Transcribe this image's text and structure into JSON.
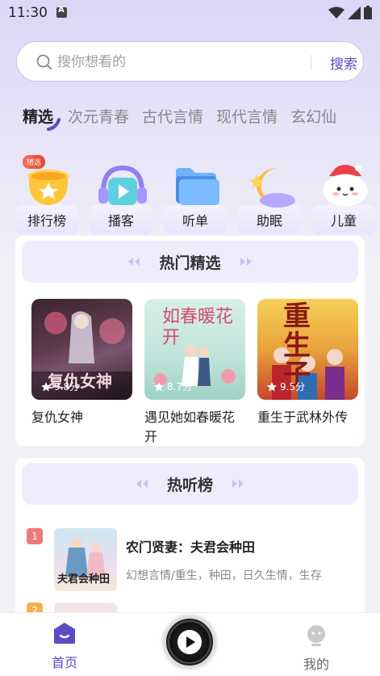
{
  "status_bar": {
    "time": "11:30"
  },
  "search": {
    "placeholder": "搜你想看的",
    "button_label": "搜索"
  },
  "tabs": [
    {
      "label": "精选",
      "active": true
    },
    {
      "label": "次元青春"
    },
    {
      "label": "古代言情"
    },
    {
      "label": "现代言情"
    },
    {
      "label": "玄幻仙"
    }
  ],
  "categories": [
    {
      "label": "排行榜",
      "badge": "精选",
      "icon": "trophy-pot-icon"
    },
    {
      "label": "播客",
      "icon": "headphones-play-icon"
    },
    {
      "label": "听单",
      "icon": "folder-icon"
    },
    {
      "label": "助眠",
      "icon": "moon-star-icon"
    },
    {
      "label": "儿童",
      "icon": "cloud-face-icon"
    }
  ],
  "featured": {
    "title": "热门精选",
    "books": [
      {
        "title": "复仇女神",
        "rating": "9.8分",
        "cover_text": "复仇女神"
      },
      {
        "title": "遇见她如春暖花开",
        "rating": "8.7分",
        "cover_text": "如春暖花开"
      },
      {
        "title": "重生于武林外传",
        "rating": "9.5分",
        "cover_text": "重生子"
      }
    ]
  },
  "hot_list": {
    "title": "热听榜",
    "items": [
      {
        "rank": "1",
        "title": "农门贤妻：夫君会种田",
        "tags": "幻想言情/重生，种田，日久生情，生存",
        "cover_text": "夫君会种田"
      },
      {
        "rank": "2",
        "title": "",
        "tags": ""
      }
    ]
  },
  "bottom_nav": {
    "home_label": "首页",
    "mine_label": "我的"
  },
  "colors": {
    "accent": "#5b4bc4",
    "rank1": "#f0787a",
    "rank2": "#f7b14e"
  }
}
